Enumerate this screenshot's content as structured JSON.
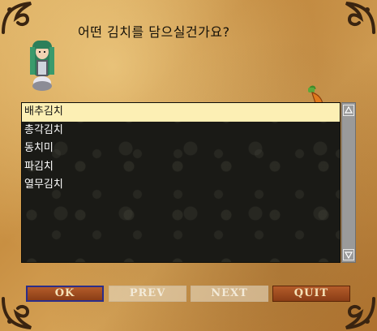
{
  "dialog": {
    "question": "어떤 김치를 담으실건가요?"
  },
  "list": {
    "selected_index": 0,
    "items": [
      {
        "label": "배추김치"
      },
      {
        "label": "총각김치"
      },
      {
        "label": "동치미"
      },
      {
        "label": "파김치"
      },
      {
        "label": "열무김치"
      }
    ]
  },
  "buttons": {
    "ok": "OK",
    "prev": "PREV",
    "next": "NEXT",
    "quit": "QUIT"
  },
  "icons": {
    "portrait": "character-portrait",
    "pepper": "pepper-icon",
    "scroll_up": "scroll-up-icon",
    "scroll_down": "scroll-down-icon"
  },
  "colors": {
    "parchment": "#c88f42",
    "list_bg": "#1a1a16",
    "selected_bg": "#fcefb4",
    "button_active": "#a04c20",
    "ok_border": "#2b2d8a"
  }
}
